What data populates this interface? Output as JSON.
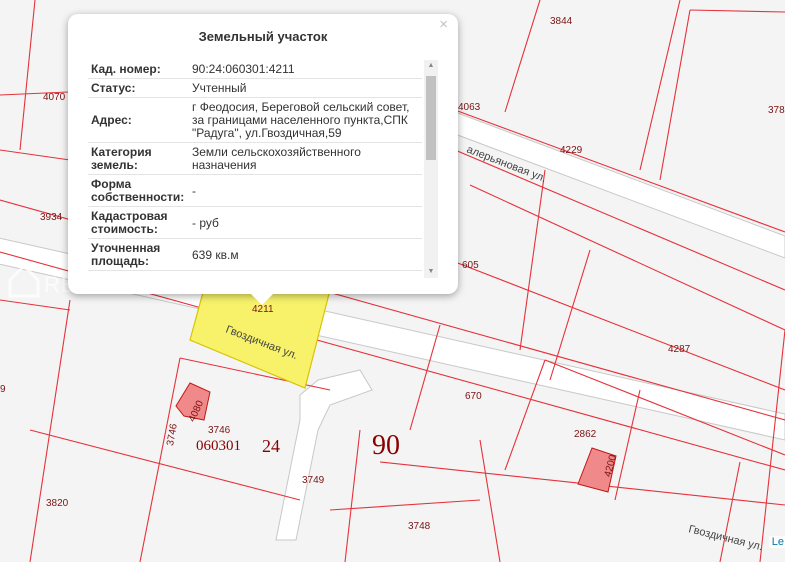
{
  "popup": {
    "title": "Земельный участок",
    "close_symbol": "×",
    "rows": [
      {
        "key": "Кад. номер:",
        "value": "90:24:060301:4211"
      },
      {
        "key": "Статус:",
        "value": "Учтенный"
      },
      {
        "key": "Адрес:",
        "value": "г Феодосия, Береговой сельский совет, за границами населенного пункта,СПК \"Радуга\", ул.Гвоздичная,59"
      },
      {
        "key": "Категория земель:",
        "value": "Земли сельскохозяйственного назначения"
      },
      {
        "key": "Форма собственности:",
        "value": "-"
      },
      {
        "key": "Кадастровая стоимость:",
        "value": "- руб"
      },
      {
        "key": "Уточненная площадь:",
        "value": "639 кв.м"
      }
    ]
  },
  "map": {
    "plot_numbers": {
      "p3844": "3844",
      "p4070": "4070",
      "p4063": "4063",
      "p4229": "4229",
      "p3934": "3934",
      "p605": "605",
      "p4211": "4211",
      "p4287": "4287",
      "p670": "670",
      "p4080": "4080",
      "p3746a": "3746",
      "p3746b": "3746",
      "p2862": "2862",
      "p4200": "4200",
      "p3820": "3820",
      "p3749": "3749",
      "p3748": "3748",
      "p378": "378",
      "p9": "9"
    },
    "streets": {
      "valerian": "алерьяновая ул.",
      "gvozd_upper": "Гвоздичная ул.",
      "gvozd_lower": "Гвоздичная ул."
    },
    "cadastral_labels": {
      "kvartal": "060301",
      "zone": "24",
      "region": "90"
    },
    "watermark": "REINPORT.COM",
    "attribution": "Le",
    "colors": {
      "boundary": "#e5323b",
      "selected_fill": "#f7f26a",
      "building_fill": "#f08a8a",
      "road": "#ffffff"
    }
  }
}
